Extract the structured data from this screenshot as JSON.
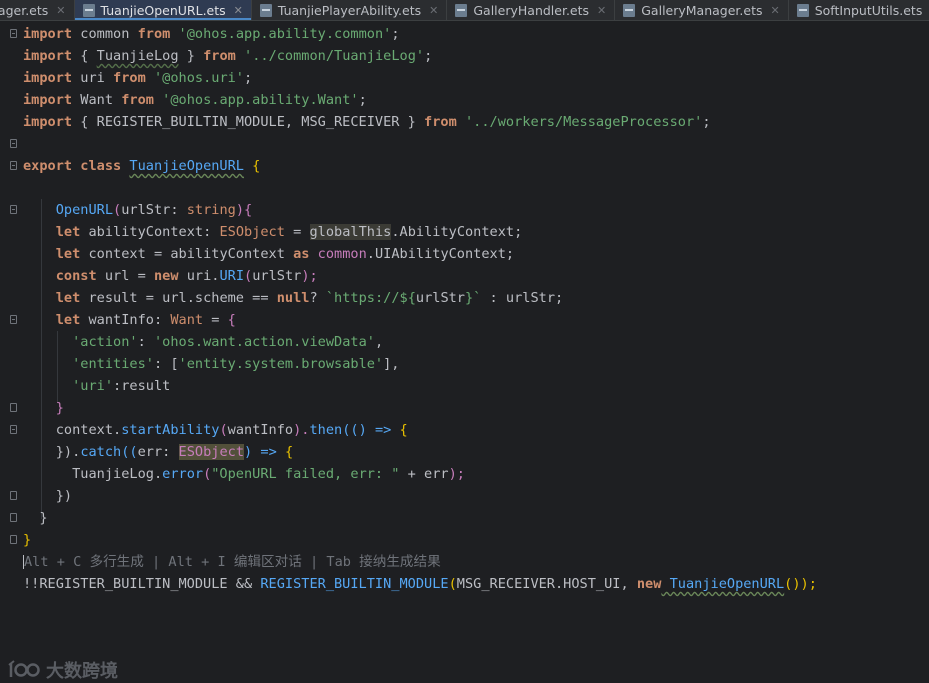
{
  "tabs": [
    {
      "label": "nager.ets",
      "active": false
    },
    {
      "label": "TuanjieOpenURL.ets",
      "active": true
    },
    {
      "label": "TuanjiePlayerAbility.ets",
      "active": false
    },
    {
      "label": "GalleryHandler.ets",
      "active": false
    },
    {
      "label": "GalleryManager.ets",
      "active": false
    },
    {
      "label": "SoftInputUtils.ets",
      "active": false
    },
    {
      "label": "T",
      "active": false
    }
  ],
  "code": {
    "l1": {
      "import": "import",
      "common": " common ",
      "from": "from",
      "str": "'@ohos.app.ability.common'",
      "end": ";"
    },
    "l2": {
      "import": "import",
      "a": " { ",
      "name": "TuanjieLog",
      "b": " } ",
      "from": "from",
      "str": "'../common/TuanjieLog'",
      "end": ";"
    },
    "l3": {
      "import": "import",
      "a": " uri ",
      "from": "from",
      "str": "'@ohos.uri'",
      "end": ";"
    },
    "l4": {
      "import": "import",
      "a": " Want ",
      "from": "from",
      "str": "'@ohos.app.ability.Want'",
      "end": ";"
    },
    "l5": {
      "import": "import",
      "a": " { REGISTER_BUILTIN_MODULE, MSG_RECEIVER } ",
      "from": "from",
      "str": "'../workers/MessageProcessor'",
      "end": ";"
    },
    "l7": {
      "export": "export",
      "class": "class",
      "name": "TuanjieOpenURL",
      "brace": " {"
    },
    "l9": {
      "fn": "OpenURL",
      "p1": "(",
      "param": "urlStr",
      "colon": ": ",
      "type": "string",
      "p2": "){"
    },
    "l10": {
      "let": "let",
      "a": " abilityContext: ",
      "type": "ESObject",
      "eq": " = ",
      "glob": "globalThis",
      "rest": ".AbilityContext;"
    },
    "l11": {
      "let": "let",
      "a": " context = abilityContext ",
      "as": "as",
      "ns": " common",
      "rest": ".UIAbilityContext;"
    },
    "l12": {
      "const": "const",
      "a": " url = ",
      "new": "new",
      "b": " uri.",
      "fn": "URI",
      "p1": "(",
      "arg": "urlStr",
      "p2": ");"
    },
    "l13": {
      "let": "let",
      "a": " result = url.scheme == ",
      "nul": "null",
      "b": "? ",
      "tpl1": "`https://${",
      "tv": "urlStr",
      "tpl2": "}`",
      "c": " : urlStr;"
    },
    "l14": {
      "let": "let",
      "a": " wantInfo: ",
      "type": "Want",
      "b": " = ",
      "brace": "{"
    },
    "l15": {
      "key": "'action'",
      "c": ": ",
      "val": "'ohos.want.action.viewData'",
      "end": ","
    },
    "l16": {
      "key": "'entities'",
      "c": ": [",
      "val": "'entity.system.browsable'",
      "end": "],"
    },
    "l17": {
      "key": "'uri'",
      "c": ":result"
    },
    "l18": {
      "brace": "}"
    },
    "l19": {
      "a": "context.",
      "fn": "startAbility",
      "p1": "(",
      "arg": "wantInfo",
      "p2": ").",
      "fn2": "then",
      "p3": "((",
      "p4": ") => ",
      "brace": "{"
    },
    "l20": {
      "a": "}).",
      "fn": "catch",
      "p1": "((",
      "arg": "err: ",
      "type": "ESObject",
      "p2": ") => ",
      "brace": "{"
    },
    "l21": {
      "name": "TuanjieLog",
      "dot": ".",
      "fn": "error",
      "p1": "(",
      "str": "\"OpenURL failed, err: \"",
      "rest": " + err",
      "p2": ");"
    },
    "l22": {
      "a": "})"
    },
    "l23": {
      "a": "}"
    },
    "l24": {
      "a": "}"
    },
    "l25": {
      "hint": "Alt + C 多行生成 | Alt + I 编辑区对话 | Tab 接纳生成结果"
    },
    "l26": {
      "a": "!!REGISTER_BUILTIN_MODULE && ",
      "fn": "REGISTER_BUILTIN_MODULE",
      "p1": "(",
      "b": "MSG_RECEIVER.HOST_UI, ",
      "new": "new",
      "name": " TuanjieOpenURL",
      "p2": "());"
    }
  },
  "watermark": {
    "text": "大数跨境"
  }
}
